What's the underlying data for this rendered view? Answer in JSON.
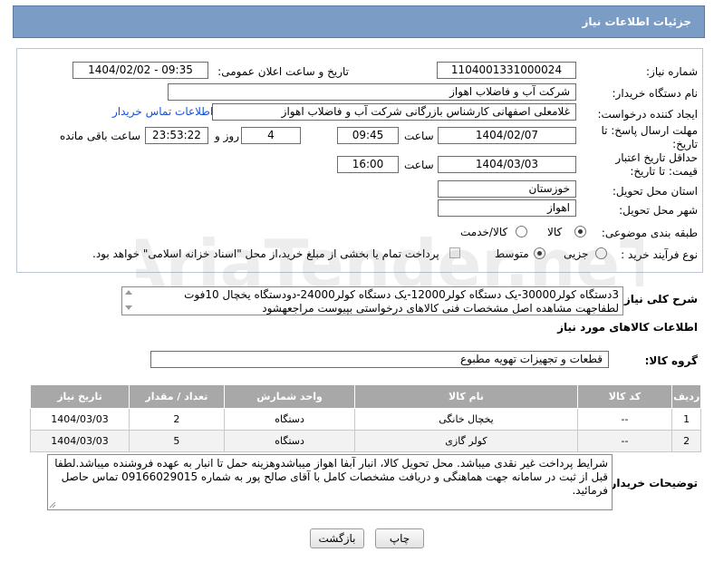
{
  "header": {
    "title": "جزئیات اطلاعات نیاز"
  },
  "fields": {
    "need_number_label": "شماره نیاز:",
    "need_number": "1104001331000024",
    "announce_label": "تاریخ و ساعت اعلان عمومی:",
    "announce_value": "1404/02/02 - 09:35",
    "buyer_label": "نام دستگاه خریدار:",
    "buyer_value": "شرکت آب و فاضلاب اهواز",
    "requester_label": "ایجاد کننده درخواست:",
    "requester_value": "غلامعلی اصفهانی کارشناس بازرگانی شرکت آب و فاضلاب اهواز",
    "contact_link": "اطلاعات تماس خریدار",
    "send_deadline_label": "مهلت ارسال پاسخ: تا تاریخ:",
    "send_date": "1404/02/07",
    "time_label": "ساعت",
    "send_time": "09:45",
    "days_value": "4",
    "days_label": "روز و",
    "remaining_time": "23:53:22",
    "remaining_label": "ساعت باقی مانده",
    "price_deadline_label": "حداقل تاریخ اعتبار قیمت: تا تاریخ:",
    "price_date": "1404/03/03",
    "price_time": "16:00",
    "province_label": "استان محل تحویل:",
    "province_value": "خوزستان",
    "city_label": "شهر محل تحویل:",
    "city_value": "اهواز",
    "category_label": "طبقه بندی موضوعی:",
    "category_options": [
      "کالا",
      "کالا/خدمت"
    ],
    "process_label": "نوع فرآیند خرید :",
    "process_options": [
      "جزیی",
      "متوسط"
    ],
    "payment_text": "پرداخت تمام یا بخشی از مبلغ خرید،از محل \"اسناد خزانه اسلامی\" خواهد بود."
  },
  "description": {
    "label": "شرح کلی نیاز:",
    "text": "3دستگاه کولر30000-یک دستگاه کولر12000-یک دستگاه کولر24000-دودستگاه یخچال 10فوت لطفاجهت مشاهده اصل مشخصات فنی کالاهای درخواستی بپیوست مراجعهشود"
  },
  "goods_info": {
    "title": "اطلاعات کالاهای مورد نیاز",
    "group_label": "گروه کالا:",
    "group_value": "قطعات و تجهیزات تهویه مطبوع"
  },
  "table": {
    "headers": [
      "ردیف",
      "کد کالا",
      "نام کالا",
      "واحد شمارش",
      "تعداد / مقدار",
      "تاریخ نیاز"
    ],
    "rows": [
      [
        "1",
        "--",
        "یخچال خانگی",
        "دستگاه",
        "2",
        "1404/03/03"
      ],
      [
        "2",
        "--",
        "کولر گازی",
        "دستگاه",
        "5",
        "1404/03/03"
      ]
    ]
  },
  "buyer_notes": {
    "label": "توضیحات خریدار:",
    "text": "شرایط پرداخت غیر نقدی میباشد. محل تحویل کالا، انبار آبفا اهواز میباشدوهزینه حمل تا انبار به عهده فروشنده میباشد.لطفا قبل از ثبت در سامانه جهت هماهنگی و دریافت مشخصات کامل با آقای  صالح پور به شماره 09166029015 تماس حاصل فرمائید."
  },
  "buttons": {
    "print": "چاپ",
    "back": "بازگشت"
  },
  "watermark": {
    "text": "AriaTender.neT"
  }
}
